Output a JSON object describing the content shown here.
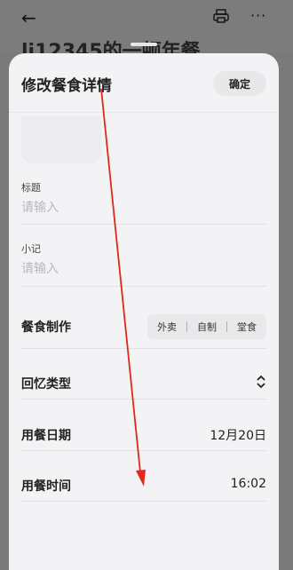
{
  "background": {
    "back_icon": "arrow-left-icon",
    "printer_icon": "printer-icon",
    "more_icon": "more-horizontal-icon",
    "title": "lj12345的一顿年餐"
  },
  "sheet": {
    "title": "修改餐食详情",
    "confirm_label": "确定",
    "title_field": {
      "label": "标题",
      "placeholder": "请输入",
      "value": ""
    },
    "note_field": {
      "label": "小记",
      "placeholder": "请输入",
      "value": ""
    },
    "meal_making": {
      "label": "餐食制作",
      "options": [
        "外卖",
        "自制",
        "堂食"
      ]
    },
    "memory_type": {
      "label": "回忆类型",
      "icon": "chevron-up-down-icon"
    },
    "meal_date": {
      "label": "用餐日期",
      "value": "12月20日"
    },
    "meal_time": {
      "label": "用餐时间",
      "value": "16:02"
    }
  },
  "colors": {
    "arrow": "#e0281e",
    "sheet_bg": "#f3f3f5",
    "overlay": "#7a7a7a"
  }
}
